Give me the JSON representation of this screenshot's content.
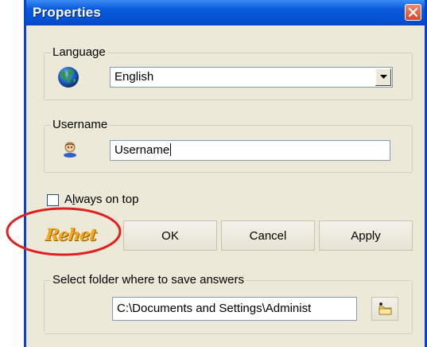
{
  "window": {
    "title": "Properties"
  },
  "language_group": {
    "legend": "Language",
    "selected": "English",
    "icon": "globe-icon"
  },
  "username_group": {
    "legend": "Username",
    "value": "Username",
    "icon": "user-icon"
  },
  "always_on_top": {
    "label_prefix": "A",
    "label_underlined": "l",
    "label_suffix": "ways on top",
    "checked": false
  },
  "logo": {
    "text": "Rehet"
  },
  "buttons": {
    "ok": "OK",
    "cancel": "Cancel",
    "apply": "Apply"
  },
  "folder_group": {
    "legend": "Select folder where to save answers",
    "path": "C:\\Documents and Settings\\Administ",
    "browse_icon": "folder-browse-icon"
  },
  "colors": {
    "titlebar": "#0A5BDA",
    "window_bg": "#ECE9D8",
    "close_button": "#D9452A",
    "highlight_ring": "#E02020",
    "logo": "#F2A81D"
  }
}
